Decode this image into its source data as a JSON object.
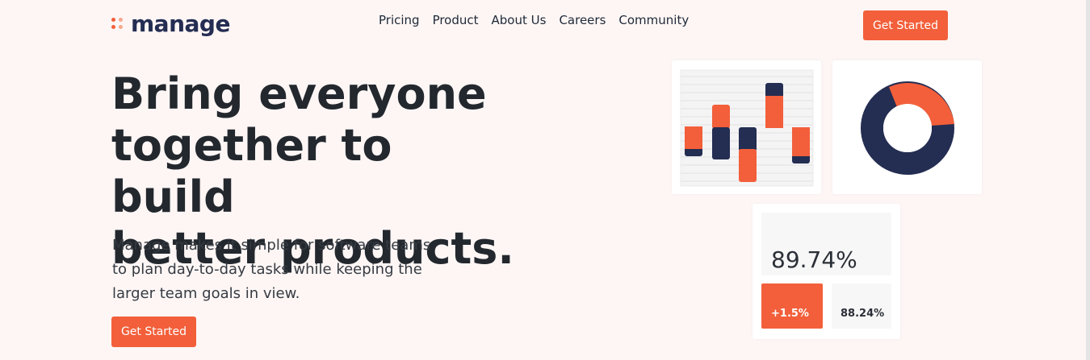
{
  "brand": {
    "name": "manage",
    "accent": "#f25f3a",
    "accent_light": "#f8a78f",
    "navy": "#242d52"
  },
  "nav": {
    "items": [
      "Pricing",
      "Product",
      "About Us",
      "Careers",
      "Community"
    ]
  },
  "header": {
    "cta_label": "Get Started"
  },
  "hero": {
    "title_lines": [
      "Bring everyone",
      "together to build",
      "better products."
    ],
    "description_lines": [
      "Manage makes it simple for software teams",
      "to plan day-to-day tasks while keeping the",
      "larger team goals in view."
    ],
    "cta_label": "Get Started"
  },
  "stats": {
    "main": "89.74%",
    "up": "+1.5%",
    "alt": "88.24%"
  }
}
